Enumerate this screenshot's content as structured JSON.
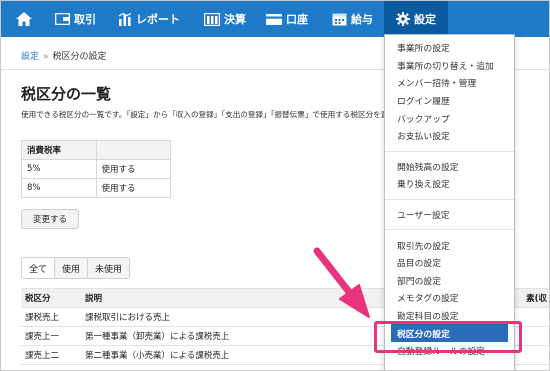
{
  "nav": {
    "items": [
      {
        "label": "取引",
        "icon": "wallet-icon"
      },
      {
        "label": "レポート",
        "icon": "bar-chart-icon"
      },
      {
        "label": "決算",
        "icon": "book-icon"
      },
      {
        "label": "口座",
        "icon": "card-icon"
      },
      {
        "label": "給与",
        "icon": "calendar-icon"
      },
      {
        "label": "設定",
        "icon": "gear-icon"
      }
    ]
  },
  "breadcrumb": {
    "root": "設定",
    "separator": "»",
    "current": "税区分の設定"
  },
  "page": {
    "title": "税区分の一覧",
    "description": "使用できる税区分の一覧です。「設定」から「収入の登録」「支出の登録」「振替伝票」で使用する税区分を選択できます"
  },
  "tax_table": {
    "header": "消費税率",
    "rows": [
      {
        "rate": "5%",
        "status": "使用する"
      },
      {
        "rate": "8%",
        "status": "使用する"
      }
    ]
  },
  "change_button": "変更する",
  "filters": [
    "全て",
    "使用",
    "未使用"
  ],
  "category_table": {
    "headers": [
      "税区分",
      "説明",
      "素(収"
    ],
    "rows": [
      {
        "code": "課税売上",
        "desc": "課税取引における売上"
      },
      {
        "code": "課売上一",
        "desc": "第一種事業（卸売業）による課税売上"
      },
      {
        "code": "課売上二",
        "desc": "第二種事業（小売業）による課税売上"
      }
    ]
  },
  "dropdown": {
    "groups": [
      [
        "事業所の設定",
        "事業所の切り替え・追加",
        "メンバー招待・管理",
        "ログイン履歴",
        "バックアップ",
        "お支払い設定"
      ],
      [
        "開始残高の設定",
        "乗り換え設定"
      ],
      [
        "ユーザー設定"
      ],
      [
        "取引先の設定",
        "品目の設定",
        "部門の設定",
        "メモタグの設定",
        "勘定科目の設定",
        "税区分の設定",
        "自動登録ルールの設定"
      ]
    ],
    "selected": "税区分の設定"
  },
  "colors": {
    "navbar": "#1f7ac8",
    "nav_active": "#0c5aa0",
    "highlight": "#e8337f",
    "selected_item": "#2b6cb8"
  }
}
